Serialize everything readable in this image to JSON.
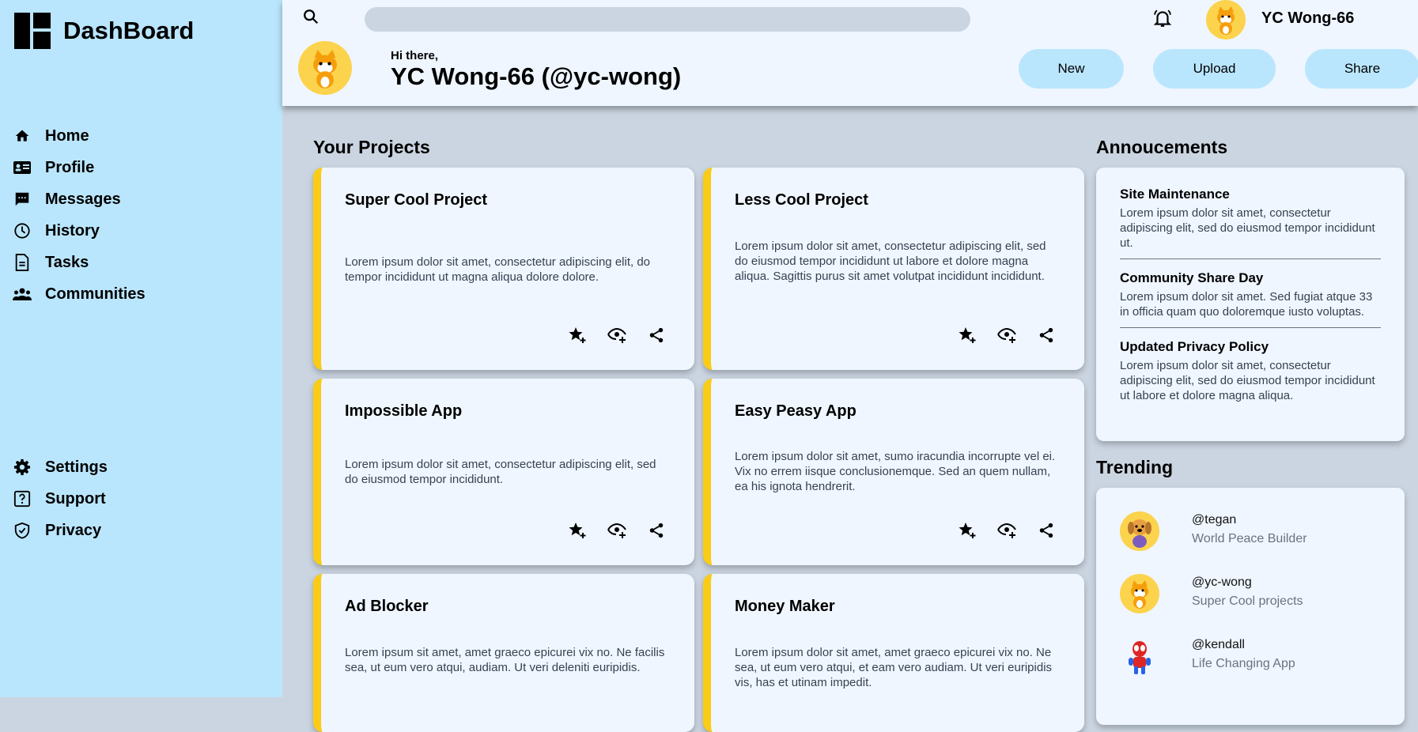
{
  "brand": {
    "title": "DashBoard"
  },
  "nav": {
    "main": [
      {
        "label": "Home",
        "icon": "home-icon"
      },
      {
        "label": "Profile",
        "icon": "id-card-icon"
      },
      {
        "label": "Messages",
        "icon": "chat-icon"
      },
      {
        "label": "History",
        "icon": "clock-icon"
      },
      {
        "label": "Tasks",
        "icon": "document-icon"
      },
      {
        "label": "Communities",
        "icon": "group-icon"
      }
    ],
    "bottom": [
      {
        "label": "Settings",
        "icon": "gear-icon"
      },
      {
        "label": "Support",
        "icon": "help-icon"
      },
      {
        "label": "Privacy",
        "icon": "shield-icon"
      }
    ]
  },
  "header": {
    "search_placeholder": "",
    "user_name": "YC Wong-66",
    "greeting": "Hi there,",
    "user_full": "YC Wong-66 (@yc-wong)",
    "buttons": {
      "new": "New",
      "upload": "Upload",
      "share": "Share"
    }
  },
  "projects": {
    "title": "Your Projects",
    "items": [
      {
        "title": "Super Cool Project",
        "desc": "Lorem ipsum dolor sit amet, consectetur adipiscing elit, do tempor incididunt ut magna aliqua dolore dolore."
      },
      {
        "title": "Less Cool Project",
        "desc": "Lorem ipsum dolor sit amet, consectetur adipiscing elit, sed do eiusmod tempor incididunt ut labore et dolore magna aliqua. Sagittis purus sit amet volutpat incididunt incididunt."
      },
      {
        "title": "Impossible App",
        "desc": "Lorem ipsum dolor sit amet, consectetur adipiscing elit, sed do eiusmod tempor incididunt."
      },
      {
        "title": "Easy Peasy App",
        "desc": "Lorem ipsum dolor sit amet, sumo iracundia incorrupte vel ei. Vix no errem iisque conclusionemque. Sed an quem nullam, ea his ignota hendrerit."
      },
      {
        "title": "Ad Blocker",
        "desc": "Lorem ipsum sit amet, amet graeco epicurei vix no. Ne facilis sea, ut eum vero atqui, audiam. Ut veri deleniti euripidis."
      },
      {
        "title": "Money Maker",
        "desc": "Lorem ipsum dolor sit amet, amet graeco epicurei vix no. Ne sea, ut eum vero atqui, et eam vero audiam. Ut veri euripidis vis, has et utinam impedit."
      }
    ]
  },
  "announcements": {
    "title": "Annoucements",
    "items": [
      {
        "title": "Site Maintenance",
        "body": "Lorem ipsum dolor sit amet, consectetur adipiscing elit, sed do eiusmod tempor incididunt ut."
      },
      {
        "title": "Community Share Day",
        "body": "Lorem ipsum dolor sit amet. Sed fugiat atque 33 in officia quam quo doloremque iusto voluptas."
      },
      {
        "title": "Updated Privacy Policy",
        "body": "Lorem ipsum dolor sit amet, consectetur adipiscing elit, sed do eiusmod tempor incididunt ut labore et dolore magna aliqua."
      }
    ]
  },
  "trending": {
    "title": "Trending",
    "items": [
      {
        "handle": "@tegan",
        "sub": "World Peace Builder",
        "avatar": "dog-avatar"
      },
      {
        "handle": "@yc-wong",
        "sub": "Super Cool projects",
        "avatar": "cat-avatar"
      },
      {
        "handle": "@kendall",
        "sub": "Life Changing App",
        "avatar": "spider-avatar"
      }
    ]
  },
  "colors": {
    "sidebar": "#bae6fd",
    "header": "#eff6ff",
    "main": "#cbd5e1",
    "accent": "#facc15",
    "avatar_bg": "#fcd34d"
  }
}
